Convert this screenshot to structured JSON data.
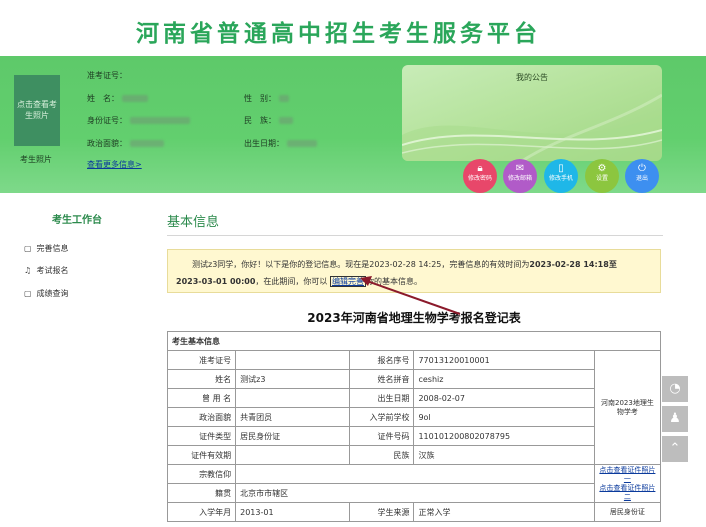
{
  "site": {
    "title": "河南省普通高中招生考生服务平台"
  },
  "profile": {
    "photo_text": "点击查看考生照片",
    "photo_label": "考生照片",
    "exam_no_label": "准考证号：",
    "name_label": "姓　名：",
    "gender_label": "性　别：",
    "id_label": "身份证号：",
    "ethnic_label": "民　族：",
    "political_label": "政治面貌：",
    "birth_label": "出生日期：",
    "more_link": "查看更多信息>"
  },
  "notice": {
    "title": "我的公告"
  },
  "actions": [
    {
      "label": "修改密码",
      "icon": "lock-icon",
      "color": "#e8476a"
    },
    {
      "label": "修改邮箱",
      "icon": "mail-icon",
      "color": "#b15bc8"
    },
    {
      "label": "修改手机",
      "icon": "phone-icon",
      "color": "#1fb7e8"
    },
    {
      "label": "设置",
      "icon": "gear-icon",
      "color": "#8cc63f"
    },
    {
      "label": "退出",
      "icon": "power-icon",
      "color": "#3d8ff0"
    }
  ],
  "sidebar": {
    "title": "考生工作台",
    "items": [
      {
        "label": "完善信息",
        "icon": "doc-icon"
      },
      {
        "label": "考试报名",
        "icon": "bell-icon"
      },
      {
        "label": "成绩查询",
        "icon": "doc-icon"
      }
    ]
  },
  "main": {
    "title": "基本信息",
    "msg_part1": "测试z3同学，你好！以下是你的登记信息。现在是2023-02-28 14:25，完善信息的有效时间为",
    "msg_bold1": "2023-02-28 14:18至",
    "msg_bold2": "2023-03-01 00:00",
    "msg_part2": "，在此期间，你可以",
    "msg_link": "编辑完善",
    "msg_part3": "你的基本信息。",
    "form_title": "2023年河南省地理生物学考报名登记表",
    "section_header": "考生基本信息",
    "fields": {
      "exam_no_label": "准考证号",
      "exam_no": "",
      "reg_no_label": "报名序号",
      "reg_no": "77013120010001",
      "name_label": "姓名",
      "name": "测试z3",
      "pinyin_label": "姓名拼音",
      "pinyin": "ceshiz",
      "used_name_label": "曾 用 名",
      "used_name": "",
      "birth_label": "出生日期",
      "birth": "2008-02-07",
      "political_label": "政治面貌",
      "political": "共青团员",
      "school_label": "入学前学校",
      "school": "9ol",
      "id_type_label": "证件类型",
      "id_type": "居民身份证",
      "id_no_label": "证件号码",
      "id_no": "110101200802078795",
      "id_valid_label": "证件有效期",
      "id_valid": "",
      "ethnic_label": "民族",
      "ethnic": "汉族",
      "religion_label": "宗教信仰",
      "religion": "",
      "origin_label": "籍贯",
      "origin": "北京市市辖区",
      "enroll_label": "入学年月",
      "enroll": "2013-01",
      "source_label": "学生来源",
      "source": "正常入学"
    },
    "side_cells": {
      "photo_note": "河南2023地理生物学考",
      "link1": "点击查看证件照片一",
      "link2": "点击查看证件照片二",
      "id_card_label": "居民身份证"
    }
  },
  "float": [
    {
      "icon": "wechat-icon",
      "glyph": "◔"
    },
    {
      "icon": "qq-icon",
      "glyph": "♟"
    },
    {
      "icon": "top-icon",
      "glyph": "⌃"
    }
  ]
}
